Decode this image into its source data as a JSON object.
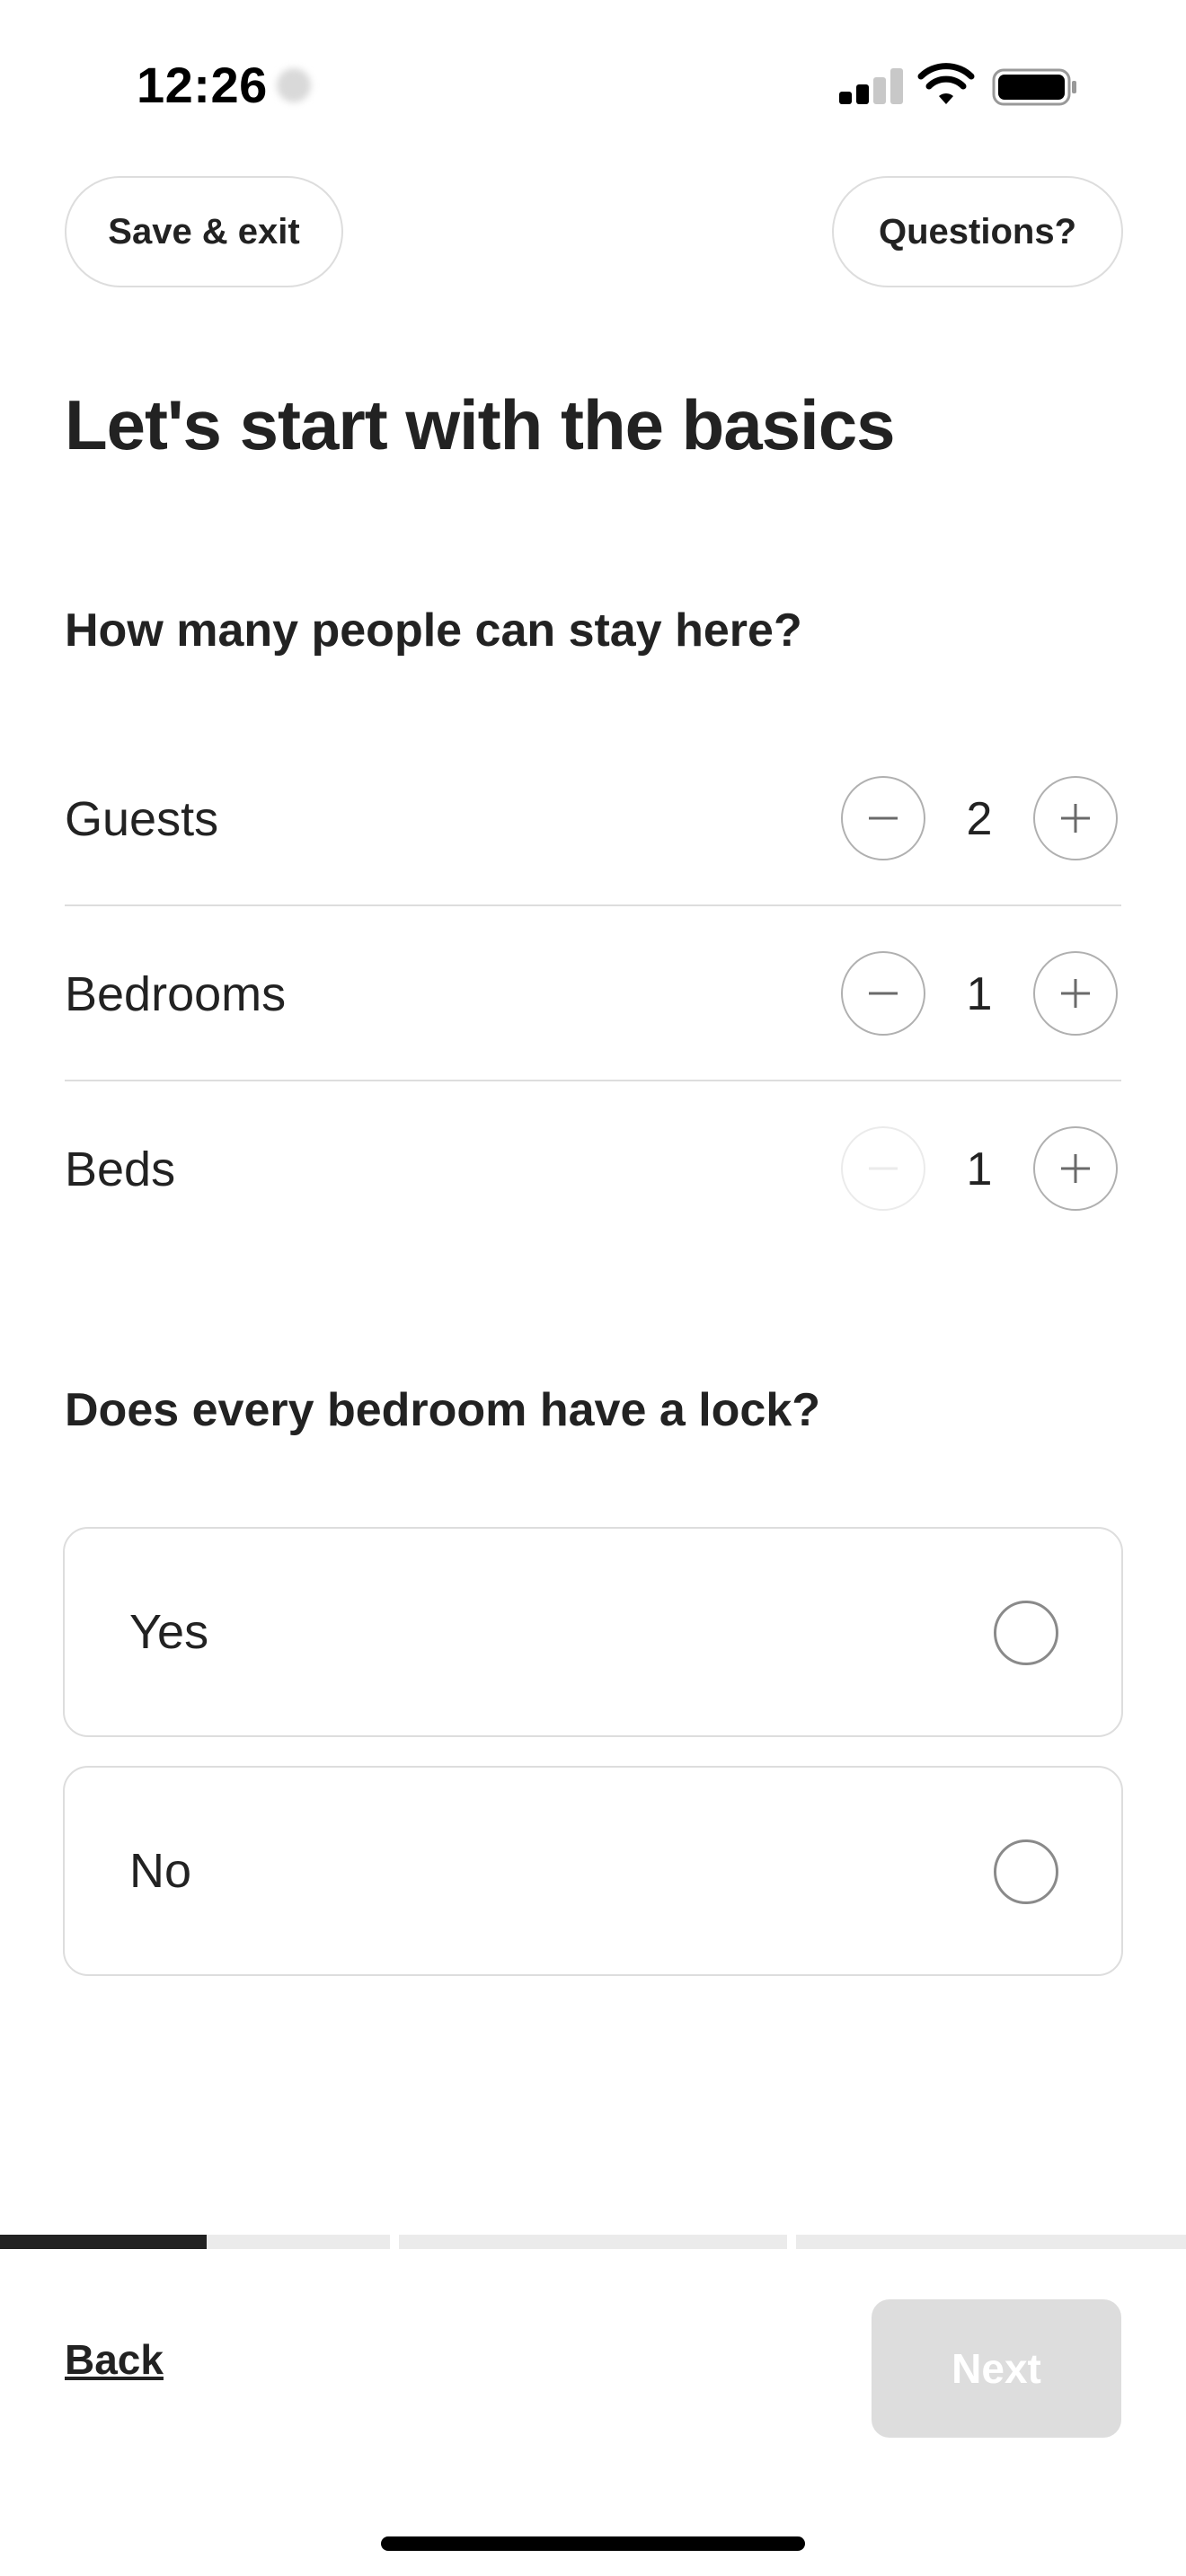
{
  "status_bar": {
    "time": "12:26"
  },
  "header": {
    "save_exit_label": "Save & exit",
    "questions_label": "Questions?"
  },
  "title": "Let's start with the basics",
  "capacity": {
    "question": "How many people can stay here?",
    "rows": [
      {
        "label": "Guests",
        "value": "2",
        "minus_enabled": true
      },
      {
        "label": "Bedrooms",
        "value": "1",
        "minus_enabled": true
      },
      {
        "label": "Beds",
        "value": "1",
        "minus_enabled": false
      }
    ]
  },
  "locks": {
    "question": "Does every bedroom have a lock?",
    "options": [
      {
        "label": "Yes",
        "selected": false
      },
      {
        "label": "No",
        "selected": false
      }
    ]
  },
  "progress": {
    "steps_total": 3,
    "current_step": 1,
    "current_step_fraction": 0.53
  },
  "footer": {
    "back_label": "Back",
    "next_label": "Next",
    "next_enabled": false
  },
  "colors": {
    "text": "#222222",
    "border": "#dddddd",
    "disabled_button": "#dddddd",
    "progress_fill": "#222222",
    "progress_track": "#ebebeb"
  }
}
